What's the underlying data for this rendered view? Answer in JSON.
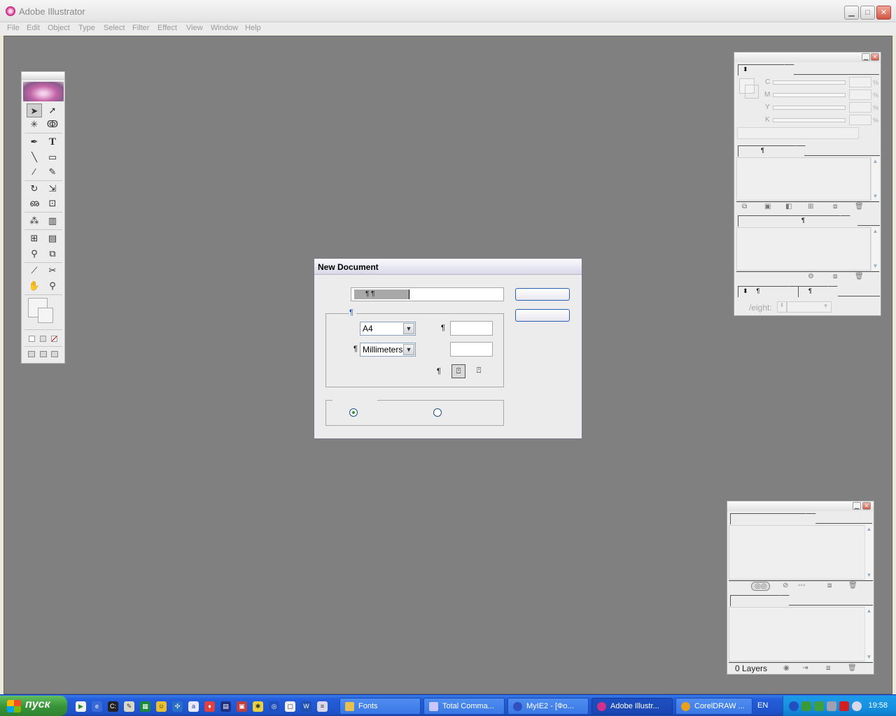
{
  "app": {
    "title": "Adobe Illustrator",
    "window_buttons": {
      "minimize": "▁",
      "maximize": "□",
      "close": "✕"
    }
  },
  "menu": [
    "File",
    "Edit",
    "Object",
    "Type",
    "Select",
    "Filter",
    "Effect",
    "View",
    "Window",
    "Help"
  ],
  "toolbox": {
    "tools": [
      {
        "name": "selection-tool",
        "glyph": "➤"
      },
      {
        "name": "direct-selection-tool",
        "glyph": "➚"
      },
      {
        "name": "magic-wand-tool",
        "glyph": "✳"
      },
      {
        "name": "lasso-tool",
        "glyph": "ↂ"
      },
      {
        "name": "pen-tool",
        "glyph": "✒"
      },
      {
        "name": "type-tool",
        "glyph": "T"
      },
      {
        "name": "line-tool",
        "glyph": "╲"
      },
      {
        "name": "rectangle-tool",
        "glyph": "▭"
      },
      {
        "name": "paintbrush-tool",
        "glyph": "⁄"
      },
      {
        "name": "pencil-tool",
        "glyph": "✎"
      },
      {
        "name": "rotate-tool",
        "glyph": "↻"
      },
      {
        "name": "scale-tool",
        "glyph": "⇲"
      },
      {
        "name": "warp-tool",
        "glyph": "ഌ"
      },
      {
        "name": "free-transform-tool",
        "glyph": "⊡"
      },
      {
        "name": "symbol-sprayer-tool",
        "glyph": "⁂"
      },
      {
        "name": "graph-tool",
        "glyph": "▥"
      },
      {
        "name": "mesh-tool",
        "glyph": "⊞"
      },
      {
        "name": "gradient-tool",
        "glyph": "▤"
      },
      {
        "name": "eyedropper-tool",
        "glyph": "⚲"
      },
      {
        "name": "blend-tool",
        "glyph": "⧉"
      },
      {
        "name": "slice-tool",
        "glyph": "⟋"
      },
      {
        "name": "scissors-tool",
        "glyph": "✂"
      },
      {
        "name": "hand-tool",
        "glyph": "✋"
      },
      {
        "name": "zoom-tool",
        "glyph": "⚲"
      }
    ]
  },
  "dialog": {
    "title": "New Document",
    "name_value": "¶ ¶",
    "size_select": "A4",
    "units_select": "Millimeters",
    "pilcrow": "¶",
    "select_arrow": "▼"
  },
  "panels": {
    "color": {
      "labels": [
        "C",
        "M",
        "Y",
        "K"
      ],
      "pct": "%"
    },
    "tab_mark": "¶",
    "stroke": {
      "weight_label": "/eight:"
    },
    "layers": {
      "status": "0 Layers"
    },
    "scroll": {
      "up": "▲",
      "down": "▼"
    }
  },
  "taskbar": {
    "start_label": "пуск",
    "tasks": [
      {
        "label": "Fonts",
        "color": "#e8c050"
      },
      {
        "label": "Total Comma...",
        "color": "#c8c8ff"
      },
      {
        "label": "MyIE2 - [Фо...",
        "color": "#3050c0"
      },
      {
        "label": "Adobe Illustr...",
        "color": "#d0308a"
      },
      {
        "label": "CorelDRAW ...",
        "color": "#e8a020"
      }
    ],
    "language": "EN",
    "clock": "19:58"
  }
}
